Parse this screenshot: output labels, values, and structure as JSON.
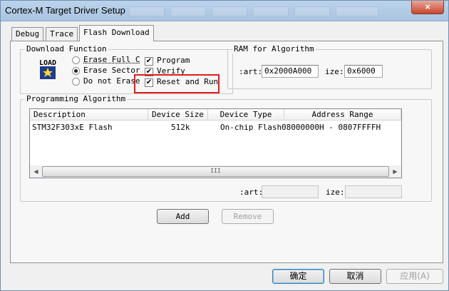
{
  "window": {
    "title": "Cortex-M Target Driver Setup",
    "close_glyph": "×"
  },
  "tabs": [
    {
      "label": "Debug"
    },
    {
      "label": "Trace"
    },
    {
      "label": "Flash Download",
      "active": true
    }
  ],
  "download_function": {
    "group_label": "Download Function",
    "icon_text": "LOAD",
    "radios": [
      {
        "label": "Erase Full C",
        "selected": false
      },
      {
        "label": "Erase Sector",
        "selected": true
      },
      {
        "label": "Do not Erase",
        "selected": false
      }
    ],
    "checkboxes": [
      {
        "label": "Program",
        "checked": true
      },
      {
        "label": "Verify",
        "checked": true
      },
      {
        "label": "Reset and Run",
        "checked": true
      }
    ],
    "check_glyph": "✔"
  },
  "ram": {
    "group_label": "RAM for Algorithm",
    "start_label": ":art:",
    "start_value": "0x2000A000",
    "size_label": "ize:",
    "size_value": "0x6000"
  },
  "programming_algorithm": {
    "group_label": "Programming Algorithm",
    "columns": [
      "Description",
      "Device Size",
      "Device Type",
      "Address Range"
    ],
    "rows": [
      {
        "description": "STM32F303xE Flash",
        "size": "512k",
        "type": "On-chip Flash",
        "range": "08000000H - 0807FFFFH"
      }
    ],
    "scroll_left": "◀",
    "scroll_right": "▶",
    "scroll_grip": "III",
    "start_label": ":art:",
    "start_value": "",
    "size_label": "ize:",
    "size_value": ""
  },
  "buttons": {
    "add": "Add",
    "remove": "Remove",
    "ok": "确定",
    "cancel": "取消",
    "apply": "应用(A)"
  },
  "colors": {
    "highlight": "#e31b1b"
  }
}
